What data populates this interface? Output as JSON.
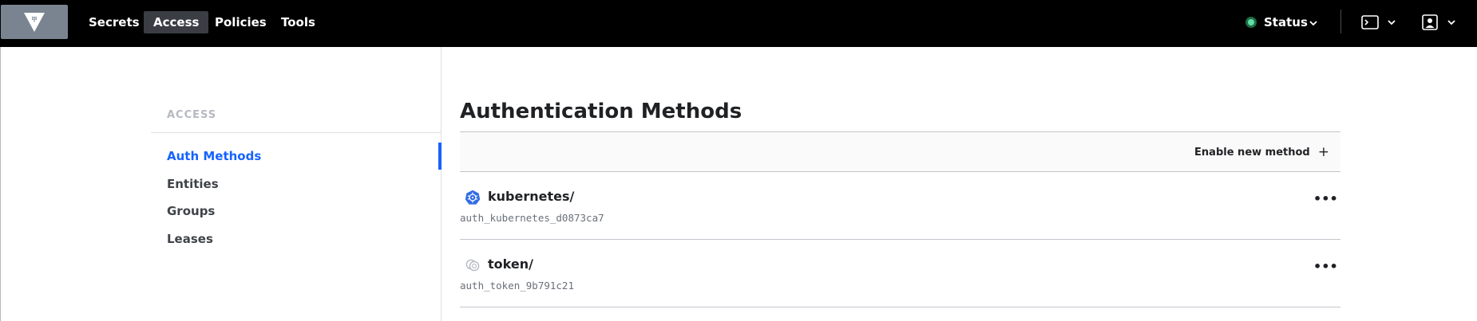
{
  "nav": {
    "items": [
      {
        "label": "Secrets"
      },
      {
        "label": "Access"
      },
      {
        "label": "Policies"
      },
      {
        "label": "Tools"
      }
    ],
    "active": "Access",
    "status_label": "Status",
    "status_color": "#60dea9"
  },
  "sidebar": {
    "heading": "ACCESS",
    "items": [
      {
        "label": "Auth Methods",
        "active": true
      },
      {
        "label": "Entities"
      },
      {
        "label": "Groups"
      },
      {
        "label": "Leases"
      }
    ]
  },
  "main": {
    "title": "Authentication Methods",
    "enable_label": "Enable new method",
    "methods": [
      {
        "path": "kubernetes/",
        "accessor": "auth_kubernetes_d0873ca7",
        "icon": "kubernetes-icon"
      },
      {
        "path": "token/",
        "accessor": "auth_token_9b791c21",
        "icon": "token-icon"
      }
    ]
  },
  "colors": {
    "accent": "#1563ff",
    "topbar": "#000000"
  }
}
